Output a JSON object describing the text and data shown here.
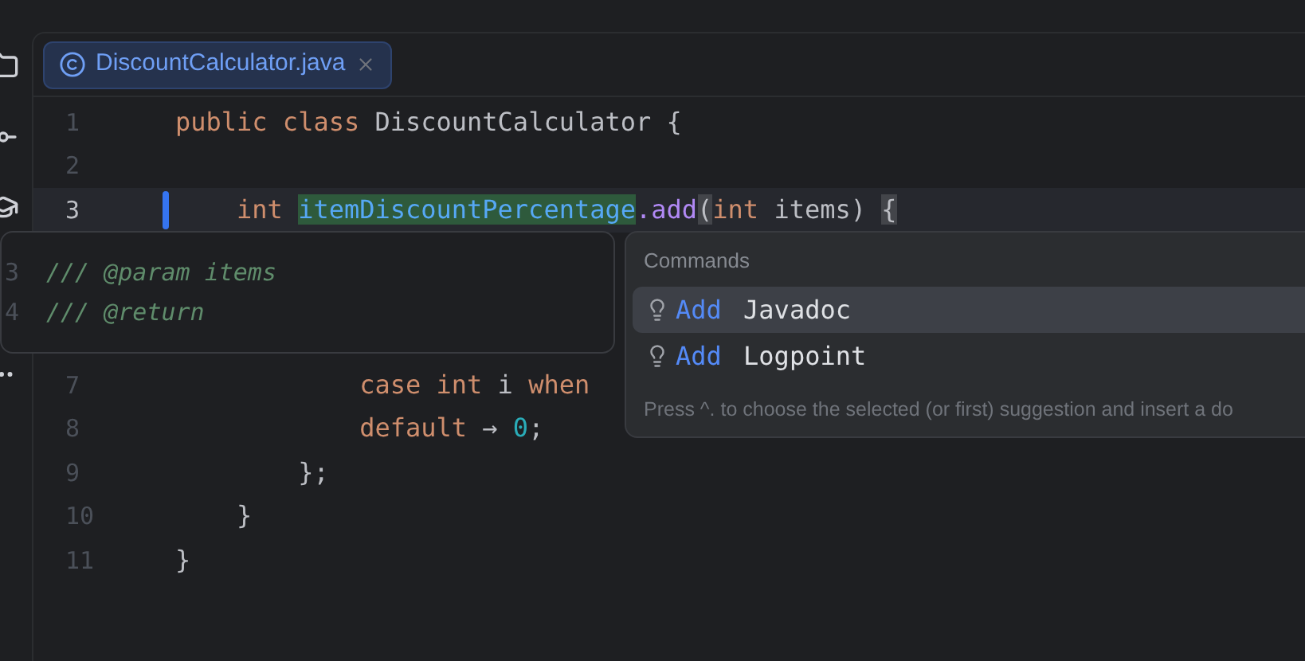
{
  "tabs": [
    {
      "label": "DiscountCalculator.java",
      "selected": true
    }
  ],
  "editor": {
    "lines_above": [
      {
        "number": "1",
        "current": false,
        "tokens": [
          {
            "text": "public class ",
            "kind": "keyword"
          },
          {
            "text": "DiscountCalculator {",
            "kind": "plain"
          }
        ]
      },
      {
        "number": "2",
        "current": false
      },
      {
        "number": "3",
        "current": true,
        "tokens": [
          {
            "text": "    int ",
            "kind": "keyword"
          },
          {
            "text": "itemDiscountPercentage",
            "kind": "highlight"
          },
          {
            "text": ".add",
            "kind": "method"
          },
          {
            "text": "(",
            "kind": "brace"
          },
          {
            "text": "int",
            "kind": "keyword"
          },
          {
            "text": " items) ",
            "kind": "plain"
          },
          {
            "text": "{",
            "kind": "brace"
          }
        ]
      }
    ],
    "lines_below": [
      {
        "number": "7",
        "current": false,
        "tokens": [
          {
            "text": "            case int ",
            "kind": "keyword"
          },
          {
            "text": "i ",
            "kind": "plain"
          },
          {
            "text": "when",
            "kind": "keyword"
          }
        ]
      },
      {
        "number": "8",
        "current": false,
        "tokens": [
          {
            "text": "            default ",
            "kind": "keyword"
          },
          {
            "text": "→ ",
            "kind": "plain"
          },
          {
            "text": "0",
            "kind": "number"
          },
          {
            "text": ";",
            "kind": "plain"
          }
        ]
      },
      {
        "number": "9",
        "current": false,
        "tokens": [
          {
            "text": "        };",
            "kind": "plain"
          }
        ]
      },
      {
        "number": "10",
        "current": false,
        "tokens": [
          {
            "text": "    }",
            "kind": "plain"
          }
        ]
      },
      {
        "number": "11",
        "current": false,
        "tokens": [
          {
            "text": "}",
            "kind": "plain"
          }
        ]
      }
    ]
  },
  "doc_preview": [
    {
      "number": "3",
      "text": "/// @param items"
    },
    {
      "number": "4",
      "text": "/// @return"
    }
  ],
  "commands": {
    "title": "Commands",
    "items": [
      {
        "verb": "Add",
        "label": "Javadoc",
        "selected": true
      },
      {
        "verb": "Add",
        "label": "Logpoint",
        "selected": false
      }
    ],
    "hint": "Press ^. to choose the selected (or first) suggestion and insert a do"
  }
}
